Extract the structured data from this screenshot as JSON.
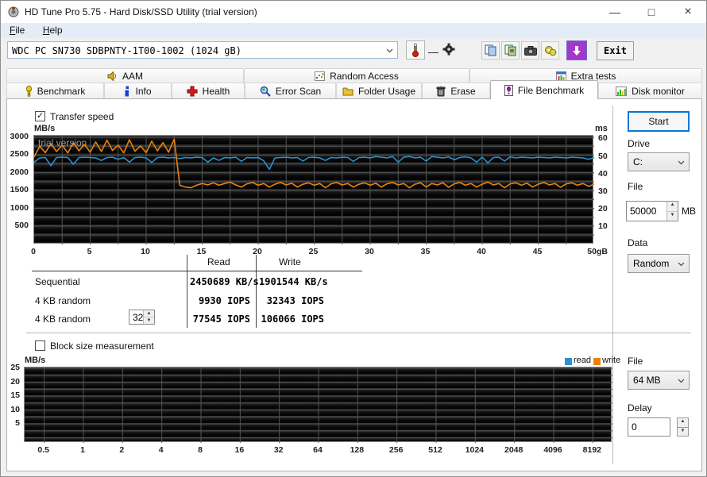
{
  "window": {
    "title": "HD Tune Pro 5.75 - Hard Disk/SSD Utility (trial version)",
    "controls": {
      "minimize": "—",
      "maximize": "□",
      "close": "×"
    }
  },
  "menu": {
    "items": [
      {
        "label": "File"
      },
      {
        "label": "Help"
      }
    ]
  },
  "toolbar": {
    "drive_combo": "WDC PC SN730 SDBPNTY-1T00-1002 (1024 gB)",
    "temperature_value": "—",
    "exit_label": "Exit"
  },
  "tabs_row1": [
    {
      "label": "AAM"
    },
    {
      "label": "Random Access"
    },
    {
      "label": "Extra tests"
    }
  ],
  "tabs_row2": [
    {
      "label": "Benchmark"
    },
    {
      "label": "Info"
    },
    {
      "label": "Health"
    },
    {
      "label": "Error Scan"
    },
    {
      "label": "Folder Usage"
    },
    {
      "label": "Erase"
    },
    {
      "label": "File Benchmark",
      "active": true
    },
    {
      "label": "Disk monitor"
    }
  ],
  "file_benchmark": {
    "transfer_speed": {
      "label": "Transfer speed",
      "checked": true
    },
    "start_button": "Start",
    "drive": {
      "label": "Drive",
      "value": "C:"
    },
    "file_size": {
      "label": "File",
      "value": "50000",
      "unit": "MB"
    },
    "data": {
      "label": "Data",
      "value": "Random"
    },
    "results": {
      "columns": {
        "read": "Read",
        "write": "Write"
      },
      "rows": [
        {
          "label": "Sequential",
          "read": "2450689 KB/s",
          "write": "1901544 KB/s"
        },
        {
          "label": "4 KB random",
          "read": "9930 IOPS",
          "write": "32343 IOPS"
        },
        {
          "label": "4 KB random",
          "queue_depth": "32",
          "read": "77545 IOPS",
          "write": "106066 IOPS"
        }
      ]
    },
    "block_size": {
      "label": "Block size measurement",
      "checked": false,
      "file": {
        "label": "File",
        "value": "64 MB"
      },
      "delay": {
        "label": "Delay",
        "value": "0"
      },
      "legend": {
        "read": "read",
        "write": "write"
      }
    }
  },
  "colors": {
    "read_line": "#2792cc",
    "write_line": "#e8820c",
    "grid": "#545454",
    "trial_text": "#9a9a9a",
    "accent": "#0078d7",
    "purple_button": "#a238c8"
  },
  "chart_data": [
    {
      "type": "line",
      "title": "Transfer speed",
      "y_left_label": "MB/s",
      "y_right_label": "ms",
      "x_range": [
        0,
        50
      ],
      "y_range": [
        -16,
        3045
      ],
      "y_right_range": [
        0,
        62
      ],
      "x_step": 0.5,
      "grid_x_step": 2.5,
      "grid_y_step": 250,
      "watermark": "trial version",
      "x_tick_values": [
        0,
        5,
        10,
        15,
        20,
        25,
        30,
        35,
        40,
        45,
        50
      ],
      "x_tick_labels": [
        "0",
        "5",
        "10",
        "15",
        "20",
        "25",
        "30",
        "35",
        "40",
        "45",
        "50gB"
      ],
      "y_left_ticks": [
        3000,
        2500,
        2000,
        1500,
        1000,
        500
      ],
      "y_right_ticks": [
        60,
        50,
        40,
        30,
        20,
        10
      ],
      "series": [
        {
          "name": "read",
          "color": "#2792cc",
          "values": [
            2300,
            2420,
            2430,
            2200,
            2430,
            2440,
            2430,
            2240,
            2430,
            2440,
            2430,
            2420,
            2350,
            2430,
            2440,
            2380,
            2430,
            2300,
            2430,
            2440,
            2420,
            2290,
            2430,
            2440,
            2420,
            2430,
            2400,
            2430,
            2420,
            2440,
            2430,
            2300,
            2420,
            2350,
            2430,
            2420,
            2440,
            2320,
            2430,
            2420,
            2430,
            2340,
            2100,
            2420,
            2430,
            2440,
            2420,
            2430,
            2330,
            2430,
            2440,
            2420,
            2350,
            2430,
            2420,
            2440,
            2430,
            2320,
            2430,
            2440,
            2420,
            2460,
            2440,
            2420,
            2460,
            2300,
            2440,
            2460,
            2420,
            2440,
            2330,
            2460,
            2440,
            2420,
            2450,
            2370,
            2430,
            2450,
            2420,
            2300,
            2440,
            2280,
            2430,
            2440,
            2330,
            2450,
            2420,
            2440,
            2430,
            2420,
            2440,
            2430,
            2420,
            2440,
            2430,
            2420,
            2440,
            2430,
            2420,
            2380,
            2430
          ]
        },
        {
          "name": "write",
          "color": "#e8820c",
          "values": [
            2450,
            2750,
            2570,
            2820,
            2600,
            2780,
            2560,
            2850,
            2620,
            2800,
            2580,
            2870,
            2600,
            2920,
            2630,
            2780,
            2560,
            2930,
            2610,
            2760,
            2570,
            2890,
            2620,
            2850,
            2580,
            2950,
            1650,
            1600,
            1580,
            1650,
            1700,
            1660,
            1720,
            1650,
            1700,
            1740,
            1660,
            1600,
            1690,
            1730,
            1650,
            1700,
            1600,
            1680,
            1730,
            1660,
            1710,
            1600,
            1680,
            1720,
            1650,
            1700,
            1580,
            1690,
            1730,
            1660,
            1700,
            1600,
            1680,
            1720,
            1650,
            1710,
            1600,
            1690,
            1730,
            1660,
            1700,
            1580,
            1680,
            1720,
            1600,
            1700,
            1660,
            1720,
            1590,
            1690,
            1730,
            1650,
            1700,
            1600,
            1680,
            1740,
            1660,
            1700,
            1580,
            1690,
            1720,
            1650,
            1710,
            1600,
            1680,
            1730,
            1660,
            1700,
            1590,
            1690,
            1720,
            1650,
            1700,
            1620,
            1680
          ]
        }
      ]
    },
    {
      "type": "line",
      "title": "Block size measurement",
      "y_left_label": "MB/s",
      "x_tick_labels": [
        "0.5",
        "1",
        "2",
        "4",
        "8",
        "16",
        "32",
        "64",
        "128",
        "256",
        "512",
        "1024",
        "2048",
        "4096",
        "8192"
      ],
      "y_left_ticks": [
        25,
        20,
        15,
        10,
        5
      ],
      "y_range": [
        -1.8,
        25.3
      ],
      "grid_y_step": 2.5,
      "legend": [
        {
          "name": "read",
          "color": "#2792cc"
        },
        {
          "name": "write",
          "color": "#e8820c"
        }
      ],
      "series": []
    }
  ]
}
